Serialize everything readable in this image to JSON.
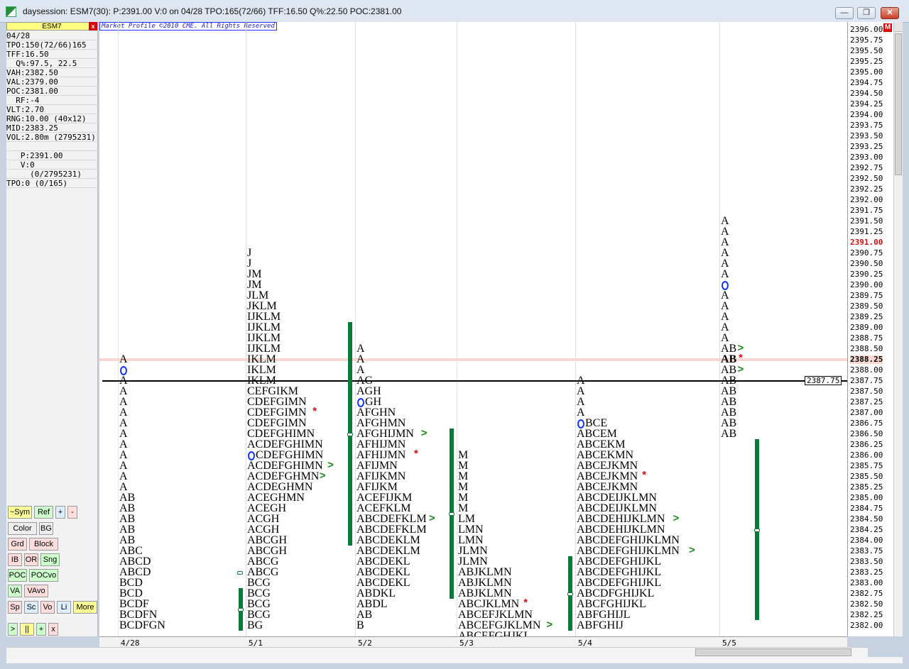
{
  "window": {
    "title": "daysession: ESM7(30): P:2391.00 V:0 on 04/28 TPO:165(72/66) TFF:16.50 Q%:22.50 POC:2381.00",
    "min_glyph": "—",
    "restore_glyph": "❐",
    "close_glyph": "✕"
  },
  "sidebar": {
    "symbol": "ESM7",
    "close_glyph": "x",
    "stats": [
      "04/28",
      "TPO:150(72/66)165",
      "TFF:16.50",
      "  Q%:97.5, 22.5",
      "VAH:2382.50",
      "VAL:2379.00",
      "POC:2381.00",
      "  RF:-4",
      "VLT:2.70",
      "RNG:10.00 (40x12)",
      "MID:2383.25",
      "VOL:2.80m (2795231)",
      "",
      "   P:2391.00",
      "   V:0",
      "     (0/2795231)",
      "TPO:0 (0/165)"
    ],
    "buttons": [
      [
        "~Sym",
        "Ref",
        "+",
        "-"
      ],
      [
        "Color",
        "BG"
      ],
      [
        "Grd",
        "Block"
      ],
      [
        "IB",
        "OR",
        "Sng"
      ],
      [
        "POC",
        "POCvo"
      ],
      [
        "VA",
        "VAvo"
      ],
      [
        "Sp",
        "Sc",
        "Vo",
        "Li",
        "More"
      ],
      [
        ">",
        "||",
        "+",
        "x"
      ]
    ]
  },
  "chart": {
    "copyright": "Market Profile ©2010 CME. All Rights Reserved",
    "last_price_tag": "2387.75",
    "dates": [
      "4/28",
      "5/1",
      "5/2",
      "5/3",
      "5/4",
      "5/5"
    ],
    "colors": {
      "green_bar": "#0a7a3a",
      "last_price": "#d01010",
      "overnight_marker": "#1133ff"
    }
  },
  "chart_data": {
    "type": "table",
    "tick": 0.25,
    "price_levels": [
      "2396.00",
      "2395.75",
      "2395.50",
      "2395.25",
      "2395.00",
      "2394.75",
      "2394.50",
      "2394.25",
      "2394.00",
      "2393.75",
      "2393.50",
      "2393.25",
      "2393.00",
      "2392.75",
      "2392.50",
      "2392.25",
      "2392.00",
      "2391.75",
      "2391.50",
      "2391.25",
      "2391.00",
      "2390.75",
      "2390.50",
      "2390.25",
      "2390.00",
      "2389.75",
      "2389.50",
      "2389.25",
      "2389.00",
      "2388.75",
      "2388.50",
      "2388.25",
      "2388.00",
      "2387.75",
      "2387.50",
      "2387.25",
      "2387.00",
      "2386.75",
      "2386.50",
      "2386.25",
      "2386.00",
      "2385.75",
      "2385.50",
      "2385.25",
      "2385.00",
      "2384.75",
      "2384.50",
      "2384.25",
      "2384.00",
      "2383.75",
      "2383.50",
      "2383.25",
      "2383.00",
      "2382.75",
      "2382.50",
      "2382.25",
      "2382.00"
    ],
    "current_price": "2391.00",
    "sessions": [
      {
        "date": "4/28",
        "top": 2388.25,
        "rows": [
          "A",
          "O",
          "A",
          "A",
          "A",
          "A",
          "A",
          "A",
          "A",
          "A",
          "A",
          "A",
          "A",
          "AB",
          "AB",
          "AB",
          "AB",
          "AB",
          "ABC",
          "ABCD",
          "ABCD",
          "BCD",
          "BCD",
          "BCDF",
          "BCDFN",
          "BCDFGN"
        ],
        "markers": [],
        "ibar": null
      },
      {
        "date": "5/1",
        "top": 2390.75,
        "rows": [
          "J",
          "J",
          "JM",
          "JM",
          "JLM",
          "JKLM",
          "IJKLM",
          "IJKLM",
          "IJKLM",
          "IJKLM",
          "IKLM",
          "IKLM",
          "IKLM",
          "CEFGIKM",
          "CDEFGIMN",
          "CDEFGIMN*",
          "CDEFGIMN",
          "CDEFGHIMN",
          "ACDEFGHIMN",
          "OCDEFGHIMN",
          "ACDEFGHIMN>",
          "ACDEFGHMN>",
          "ACDEGHMN",
          "ACEGHMN",
          "ACEGH",
          "ACGH",
          "ACGH",
          "ABCGH",
          "ABCGH",
          "ABCG",
          "ABCG",
          "BCG",
          "BCG",
          "BCG",
          "BCG",
          "BG"
        ],
        "markers": [],
        "ibar": [
          2382.75,
          2382.0
        ]
      },
      {
        "date": "5/2",
        "top": 2388.5,
        "rows": [
          "A",
          "A",
          "A",
          "AG",
          "AGH",
          "OGH",
          "AFGHN",
          "AFGHMN",
          "AFGHIJMN>",
          "AFHIJMN",
          "AFHIJMN*",
          "AFIJMN",
          "AFIJKMN",
          "AFIJKM",
          "ACEFIJKM",
          "ACEFKLM",
          "ABCDEFKLM>",
          "ABCDEFKLM",
          "ABCDEKLM",
          "ABCDEKLM",
          "ABCDEKL",
          "ABCDEKL",
          "ABCDEKL",
          "ABDKL",
          "ABDL",
          "AB",
          "B"
        ],
        "markers": [],
        "ibar": [
          2389.0,
          2384.0
        ]
      },
      {
        "date": "5/3",
        "top": 2386.0,
        "rows": [
          "M",
          "M",
          "M",
          "M",
          "M",
          "M",
          "LM",
          "LMN",
          "LMN",
          "JLMN",
          "JLMN",
          "ABJKLMN",
          "ABJKLMN",
          "ABJKLMN",
          "ABCJKLMN*",
          "ABCEFJKLMN",
          "ABCEFGJKLMN>",
          "ABCEFGHJKL"
        ],
        "markers": [],
        "ibar": [
          2386.5,
          2382.75
        ]
      },
      {
        "date": "5/4",
        "top": 2387.75,
        "rows": [
          "A",
          "A",
          "A",
          "A",
          "OBCE",
          "ABCEM",
          "ABCEKM",
          "ABCEKMN",
          "ABCEJKMN",
          "ABCEJKMN*",
          "ABCEJKMN",
          "ABCDEIJKLMN",
          "ABCDEIJKLMN",
          "ABCDEHIJKLMN>",
          "ABCDEHIJKLMN",
          "ABCDEFGHIJKLMN",
          "ABCDEFGHIJKLMN>",
          "ABCDEFGHIJKL",
          "ABCDEFGHIJKL",
          "ABCDEFGHIJKL",
          "ABCDFGHIJKL",
          "ABCFGHIJKL",
          "ABFGHIJL",
          "ABFGHIJ"
        ],
        "markers": [],
        "ibar": [
          2383.5,
          2382.0
        ]
      },
      {
        "date": "5/5",
        "top": 2391.5,
        "rows": [
          "A",
          "A",
          "A",
          "A",
          "A",
          "A",
          "O",
          "A",
          "A",
          "A",
          "A",
          "A",
          "AB>",
          "AB*",
          "AB>",
          "AB",
          "AB",
          "AB",
          "AB",
          "AB",
          "AB"
        ],
        "markers": [],
        "ibar": [
          2386.25,
          2382.25
        ]
      }
    ]
  }
}
